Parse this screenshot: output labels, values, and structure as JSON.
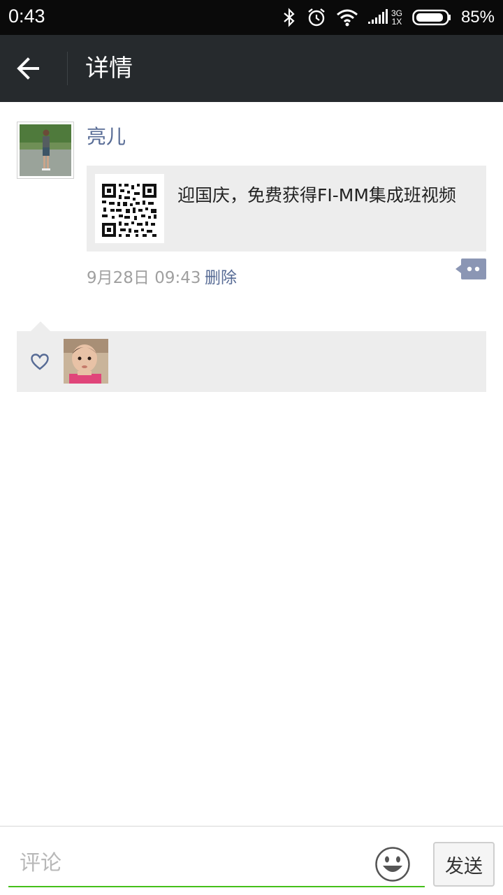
{
  "status_bar": {
    "time": "0:43",
    "network_top": "3G",
    "network_bottom": "1X",
    "battery": "85%",
    "icons": [
      "bluetooth-icon",
      "alarm-icon",
      "wifi-icon",
      "signal-icon",
      "battery-icon"
    ]
  },
  "header": {
    "title": "详情",
    "back_icon": "arrow-left-icon"
  },
  "post": {
    "author": "亮儿",
    "share_text": "迎国庆，免费获得FI-MM集成班视频",
    "timestamp": "9月28日 09:43",
    "delete_label": "删除",
    "comment_icon": "comment-bubble-icon"
  },
  "likes": {
    "icon": "heart-icon"
  },
  "comment_bar": {
    "placeholder": "评论",
    "emoji_icon": "emoji-icon",
    "send_label": "发送"
  },
  "colors": {
    "link": "#576b95",
    "titlebar": "#262a2d",
    "accent_underline": "#45c01a",
    "panel_bg": "#ededed"
  }
}
